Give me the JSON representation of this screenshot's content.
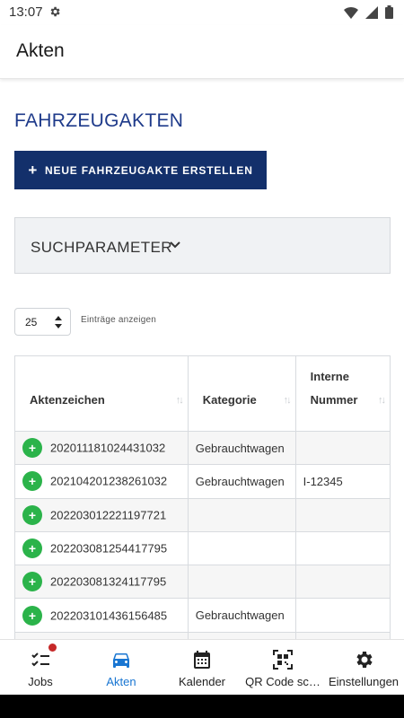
{
  "status_bar": {
    "time": "13:07"
  },
  "app_bar": {
    "title": "Akten"
  },
  "page": {
    "heading": "FAHRZEUGAKTEN",
    "new_button_label": "NEUE FAHRZEUGAKTE ERSTELLEN",
    "search_panel_label": "SUCHPARAMETER",
    "entries_value": "25",
    "entries_label": "Einträge anzeigen"
  },
  "table": {
    "headers": [
      "Aktenzeichen",
      "Kategorie",
      "Interne",
      "Nummer"
    ],
    "rows": [
      {
        "akz": "202011181024431032",
        "kategorie": "Gebrauchtwagen",
        "nummer": ""
      },
      {
        "akz": "202104201238261032",
        "kategorie": "Gebrauchtwagen",
        "nummer": "I-12345"
      },
      {
        "akz": "202203012221197721",
        "kategorie": "",
        "nummer": ""
      },
      {
        "akz": "202203081254417795",
        "kategorie": "",
        "nummer": ""
      },
      {
        "akz": "202203081324117795",
        "kategorie": "",
        "nummer": ""
      },
      {
        "akz": "202203101436156485",
        "kategorie": "Gebrauchtwagen",
        "nummer": ""
      }
    ]
  },
  "bottom_nav": {
    "items": [
      {
        "label": "Jobs",
        "icon": "checklist-icon"
      },
      {
        "label": "Akten",
        "icon": "car-icon"
      },
      {
        "label": "Kalender",
        "icon": "calendar-icon"
      },
      {
        "label": "QR Code sc…",
        "icon": "qr-code-icon"
      },
      {
        "label": "Einstellungen",
        "icon": "gear-icon"
      }
    ],
    "active_color": "#1976d2"
  },
  "colors": {
    "heading": "#1e3a8a",
    "button": "#13306b",
    "expand": "#2bb34a",
    "badge": "#c62828"
  }
}
